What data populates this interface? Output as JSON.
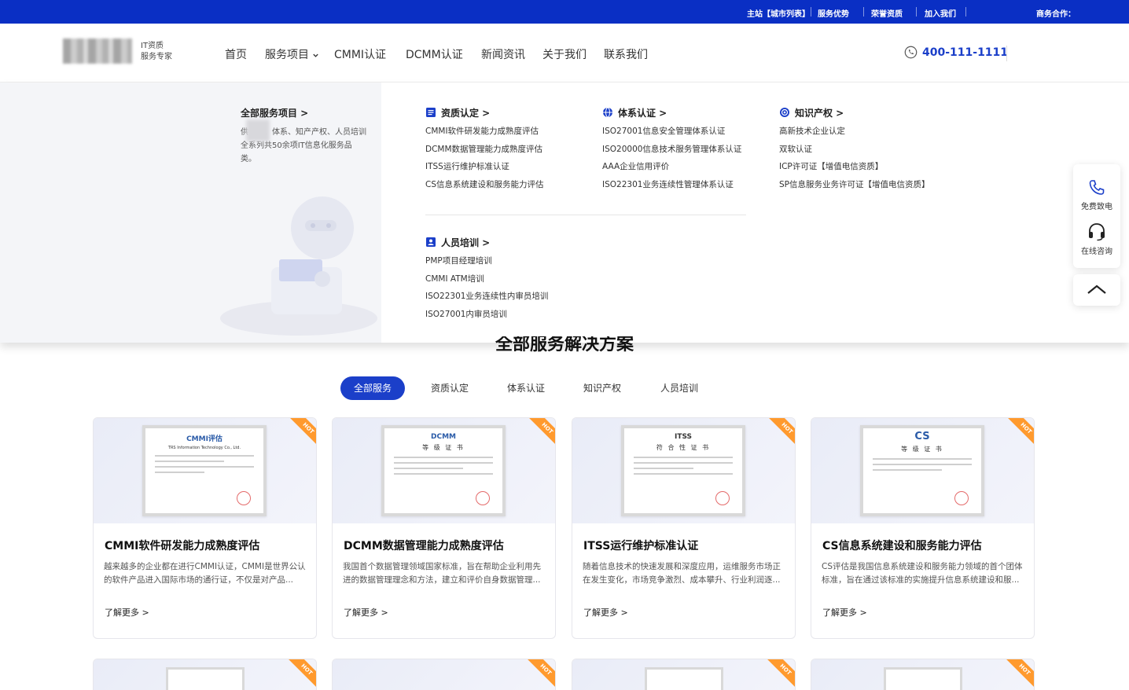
{
  "topbar": {
    "links": [
      "主站【城市列表】",
      "服务优势",
      "荣誉资质",
      "加入我们"
    ],
    "partner": "商务合作："
  },
  "header": {
    "logo_text_1": "IT资质",
    "logo_text_2": "服务专家",
    "nav": [
      "首页",
      "服务项目",
      "CMMI认证",
      "DCMM认证",
      "新闻资讯",
      "关于我们",
      "联系我们"
    ],
    "phone": "400-111-1111"
  },
  "mega": {
    "left_title": "全部服务项目 >",
    "left_desc": "供资质、体系、知产产权、人员培训全系列共50余项IT信息化服务品类。",
    "categories": [
      {
        "title": "资质认定 >",
        "icon": "document-icon",
        "items": [
          "CMMI软件研发能力成熟度评估",
          "DCMM数据管理能力成熟度评估",
          "ITSS运行维护标准认证",
          "CS信息系统建设和服务能力评估"
        ]
      },
      {
        "title": "体系认证 >",
        "icon": "globe-icon",
        "items": [
          "ISO27001信息安全管理体系认证",
          "ISO20000信息技术服务管理体系认证",
          "AAA企业信用评价",
          "ISO22301业务连续性管理体系认证"
        ]
      },
      {
        "title": "知识产权 >",
        "icon": "copyright-icon",
        "items": [
          "高新技术企业认定",
          "双软认证",
          "ICP许可证【增值电信资质】",
          "SP信息服务业务许可证【增值电信资质】"
        ]
      },
      {
        "title": "人员培训 >",
        "icon": "person-badge-icon",
        "items": [
          "PMP项目经理培训",
          "CMMI ATM培训",
          "ISO22301业务连续性内审员培训",
          "ISO27001内审员培训"
        ]
      }
    ]
  },
  "side": {
    "call": "免费致电",
    "chat": "在线咨询"
  },
  "section": {
    "title": "全部服务解决方案",
    "tabs": [
      "全部服务",
      "资质认定",
      "体系认证",
      "知识产权",
      "人员培训"
    ]
  },
  "cards": [
    {
      "title": "CMMI软件研发能力成熟度评估",
      "desc": "越来越多的企业都在进行CMMI认证，CMMI是世界公认的软件产品进入国际市场的通行证，不仅是对产品...",
      "more": "了解更多 >",
      "badge": "HOT",
      "cert_title": "CMMI评估",
      "cert_sub": "TRS Information Technology Co., Ltd."
    },
    {
      "title": "DCMM数据管理能力成熟度评估",
      "desc": "我国首个数据管理领域国家标准，旨在帮助企业利用先进的数据管理理念和方法，建立和评价自身数据管理...",
      "more": "了解更多 >",
      "badge": "HOT",
      "cert_title": "DCMM",
      "cert_sub": "等 级 证 书"
    },
    {
      "title": "ITSS运行维护标准认证",
      "desc": "随着信息技术的快速发展和深度应用，运维服务市场正在发生变化，市场竞争激烈、成本攀升、行业利润逐...",
      "more": "了解更多 >",
      "badge": "HOT",
      "cert_title": "ITSS",
      "cert_sub": "符 合 性 证 书"
    },
    {
      "title": "CS信息系统建设和服务能力评估",
      "desc": "CS评估是我国信息系统建设和服务能力领域的首个团体标准，旨在通过该标准的实施提升信息系统建设和服...",
      "more": "了解更多 >",
      "badge": "HOT",
      "cert_title": "CS",
      "cert_sub": "等 级 证 书"
    }
  ],
  "cards_row2_badges": [
    "HOT",
    "HOT",
    "HOT",
    "HOT"
  ],
  "colors": {
    "brand": "#0a2fc4",
    "accent": "#1b3fc9",
    "hot": "#ff9a2e"
  }
}
